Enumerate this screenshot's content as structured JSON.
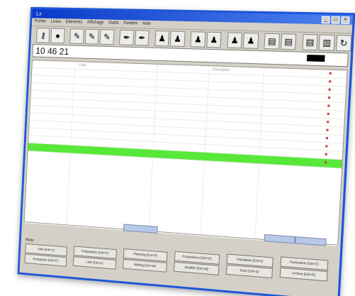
{
  "window": {
    "title": "Lx",
    "controls": [
      "_",
      "□",
      "×"
    ]
  },
  "menubar": {
    "items": [
      "Fichier",
      "Listes",
      "Eléments",
      "Affichage",
      "Outils",
      "Fenêtre",
      "Aide"
    ]
  },
  "toolbar": {
    "buttons": [
      {
        "icon": "key-icon",
        "glyph": "⚷"
      },
      {
        "icon": "disc-icon",
        "glyph": "●"
      },
      {
        "icon": "edit-icon",
        "glyph": "✎"
      },
      {
        "icon": "edit-icon",
        "glyph": "✎"
      },
      {
        "icon": "edit-icon",
        "glyph": "✎"
      },
      {
        "icon": "pen-icon",
        "glyph": "✒"
      },
      {
        "icon": "pen-icon",
        "glyph": "✒"
      },
      {
        "icon": "user-icon",
        "glyph": "♟"
      },
      {
        "icon": "user-icon",
        "glyph": "♟"
      },
      {
        "icon": "user-icon",
        "glyph": "♟"
      },
      {
        "icon": "user-icon",
        "glyph": "♟"
      },
      {
        "icon": "user-icon",
        "glyph": "♟"
      },
      {
        "icon": "user-icon",
        "glyph": "♟"
      },
      {
        "icon": "table-icon",
        "glyph": "▤"
      },
      {
        "icon": "table-icon",
        "glyph": "▤"
      },
      {
        "icon": "table-icon",
        "glyph": "▤"
      },
      {
        "icon": "chart-icon",
        "glyph": "▥"
      },
      {
        "icon": "refresh-icon",
        "glyph": "↻"
      }
    ]
  },
  "codebar": {
    "code": "10 46 21"
  },
  "colors": {
    "highlight": "#57e83a",
    "titlebar": "#0a39c8",
    "frame": "#1d56d8"
  },
  "grid": {
    "rows": [
      {
        "c1": "",
        "c2": "Code",
        "c3": "",
        "c4": "Description",
        "c5": ""
      },
      {
        "c1": "",
        "c2": "",
        "c3": "",
        "c4": "",
        "c5": ""
      },
      {
        "c1": "",
        "c2": "",
        "c3": "",
        "c4": "",
        "c5": ""
      },
      {
        "c1": "",
        "c2": "",
        "c3": "",
        "c4": "",
        "c5": ""
      },
      {
        "c1": "",
        "c2": "",
        "c3": "",
        "c4": "",
        "c5": ""
      },
      {
        "c1": "",
        "c2": "",
        "c3": "",
        "c4": "",
        "c5": ""
      },
      {
        "c1": "",
        "c2": "",
        "c3": "",
        "c4": "",
        "c5": ""
      },
      {
        "c1": "",
        "c2": "",
        "c3": "",
        "c4": "",
        "c5": ""
      },
      {
        "c1": "",
        "c2": "",
        "c3": "",
        "c4": "",
        "c5": ""
      },
      {
        "c1": "",
        "c2": "",
        "c3": "",
        "c4": "",
        "c5": ""
      },
      {
        "c1": "",
        "c2": "",
        "c3": "",
        "c4": "",
        "c5": ""
      },
      {
        "c1": "",
        "c2": "",
        "c3": "",
        "c4": "",
        "c5": ""
      }
    ],
    "highlighted_index": 11
  },
  "function_keys": {
    "label": "Mode",
    "tabs": [
      "",
      "",
      ""
    ],
    "buttons": [
      {
        "label": "Aide [Ctrl+A]"
      },
      {
        "label": "Enregistrer [Ctrl+F]"
      },
      {
        "label": "Préparation [Ctrl+F]"
      },
      {
        "label": "Liste [Ctrl+L]"
      },
      {
        "label": "Planning [Ctrl+P]"
      },
      {
        "label": "Mailing [Ctrl+M]"
      },
      {
        "label": "Propositions [Ctrl+E]"
      },
      {
        "label": "Modifier [Ctrl+M]"
      },
      {
        "label": "Imputation [Ctrl+I]"
      },
      {
        "label": "Suivi [Ctrl+S]"
      },
      {
        "label": "Facturation [Ctrl+F]"
      },
      {
        "label": "Archive [Ctrl+R]"
      }
    ]
  }
}
